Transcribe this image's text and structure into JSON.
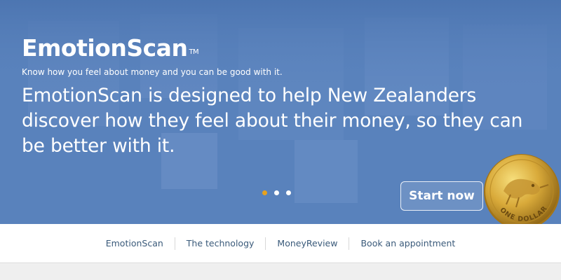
{
  "hero": {
    "logo": {
      "text": "EmotionScan",
      "trademark": "TM"
    },
    "tagline": "Know how you feel about money and you can be good with it.",
    "headline": "EmotionScan is designed to help New Zealanders discover how they feel about their money, so they can be better with it.",
    "cta_label": "Start now",
    "carousel": {
      "slide_count": 3,
      "active_index": 0
    },
    "coin": {
      "icon": "one-dollar-coin-icon",
      "text": "ONE DOLLAR"
    },
    "colors": {
      "accent_dot": "#e8a21d",
      "hero_blue": "#5a83bd"
    }
  },
  "nav": {
    "items": [
      {
        "label": "EmotionScan"
      },
      {
        "label": "The technology"
      },
      {
        "label": "MoneyReview"
      },
      {
        "label": "Book an appointment"
      }
    ]
  }
}
